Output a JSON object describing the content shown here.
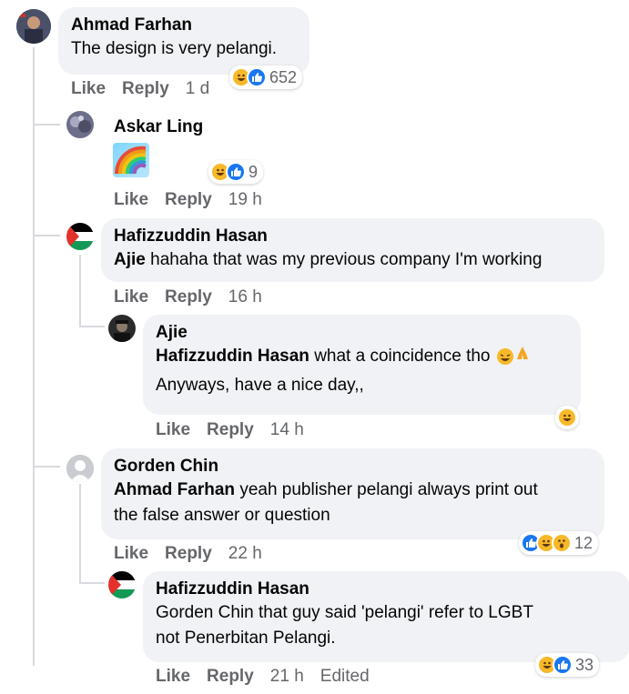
{
  "comments": [
    {
      "author": "Ahmad Farhan",
      "text": "The design is very pelangi.",
      "like": "Like",
      "reply": "Reply",
      "time": "1 d",
      "reaction_count": "652"
    },
    {
      "author": "Askar Ling",
      "like": "Like",
      "reply": "Reply",
      "time": "19 h",
      "reaction_count": "9"
    },
    {
      "author": "Hafizzuddin Hasan",
      "mention": "Ajie",
      "text": "hahaha that was my previous company I'm working",
      "like": "Like",
      "reply": "Reply",
      "time": "16 h"
    },
    {
      "author": "Ajie",
      "mention": "Hafizzuddin Hasan",
      "text": "what a coincidence tho",
      "text2": "Anyways, have a nice day,,",
      "like": "Like",
      "reply": "Reply",
      "time": "14 h"
    },
    {
      "author": "Gorden Chin",
      "mention": "Ahmad Farhan",
      "text": "yeah publisher pelangi always print out",
      "text_line2": "the false answer or question",
      "like": "Like",
      "reply": "Reply",
      "time": "22 h",
      "reaction_count": "12"
    },
    {
      "author": "Hafizzuddin Hasan",
      "text": "Gorden Chin that guy said 'pelangi' refer to LGBT",
      "text_line2": "not Penerbitan Pelangi.",
      "like": "Like",
      "reply": "Reply",
      "time": "21 h",
      "edited": "Edited",
      "reaction_count": "33"
    }
  ],
  "colors": {
    "bubble": "#f0f2f5",
    "meta": "#65676b",
    "like_blue": "#1877f2",
    "haha_yellow": "#f7b928",
    "thread_line": "#d8dade"
  }
}
